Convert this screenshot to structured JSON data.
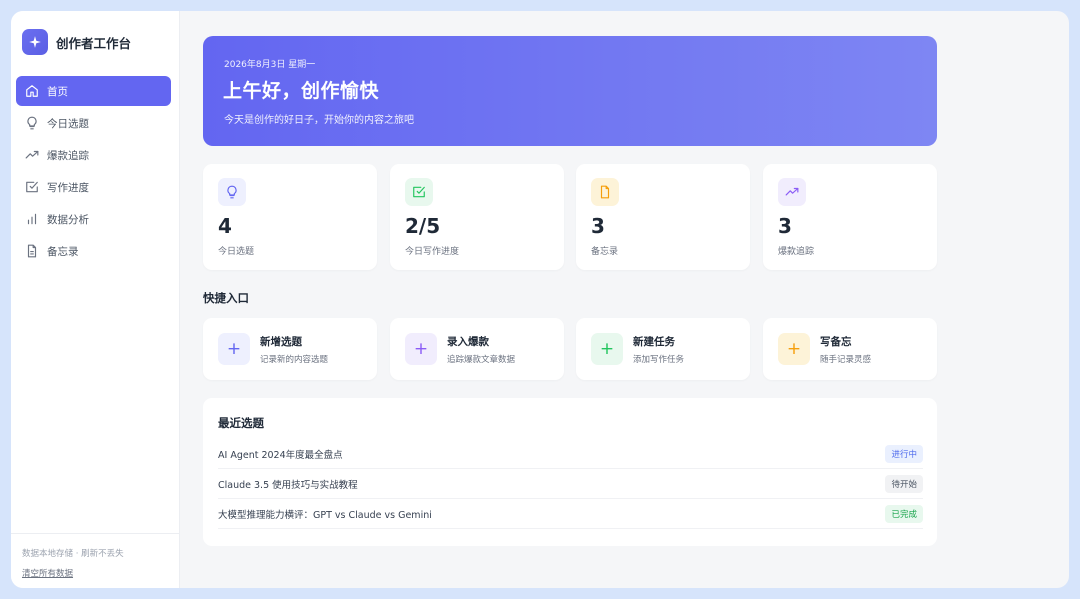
{
  "app": {
    "title": "创作者工作台"
  },
  "sidebar": {
    "items": [
      {
        "label": "首页",
        "icon": "home-icon",
        "active": true
      },
      {
        "label": "今日选题",
        "icon": "lightbulb-icon",
        "active": false
      },
      {
        "label": "爆款追踪",
        "icon": "trending-up-icon",
        "active": false
      },
      {
        "label": "写作进度",
        "icon": "checkbox-icon",
        "active": false
      },
      {
        "label": "数据分析",
        "icon": "bar-chart-icon",
        "active": false
      },
      {
        "label": "备忘录",
        "icon": "document-icon",
        "active": false
      }
    ],
    "footer_note": "数据本地存储 · 刷新不丢失",
    "clear_link": "清空所有数据"
  },
  "hero": {
    "date": "2026年8月3日 星期一",
    "greeting": "上午好，创作愉快",
    "subtitle": "今天是创作的好日子，开始你的内容之旅吧"
  },
  "stats": [
    {
      "value": "4",
      "label": "今日选题",
      "icon": "lightbulb-icon",
      "color": "#6366f1",
      "bg": "#eef0fe"
    },
    {
      "value": "2/5",
      "label": "今日写作进度",
      "icon": "checkbox-icon",
      "color": "#22c55e",
      "bg": "#e8f8ee"
    },
    {
      "value": "3",
      "label": "备忘录",
      "icon": "document-icon",
      "color": "#f59e0b",
      "bg": "#fdf3d8"
    },
    {
      "value": "3",
      "label": "爆款追踪",
      "icon": "trending-up-icon",
      "color": "#8b5cf6",
      "bg": "#f1edfd"
    }
  ],
  "quick": {
    "title": "快捷入口",
    "items": [
      {
        "title": "新增选题",
        "sub": "记录新的内容选题",
        "color": "#6366f1",
        "bg": "#eef0fe"
      },
      {
        "title": "录入爆款",
        "sub": "追踪爆款文章数据",
        "color": "#8b5cf6",
        "bg": "#f1edfd"
      },
      {
        "title": "新建任务",
        "sub": "添加写作任务",
        "color": "#22c55e",
        "bg": "#e8f8ee"
      },
      {
        "title": "写备忘",
        "sub": "随手记录灵感",
        "color": "#f59e0b",
        "bg": "#fdf3d8"
      }
    ]
  },
  "recent": {
    "title": "最近选题",
    "items": [
      {
        "title": "AI Agent 2024年度最全盘点",
        "status": "进行中",
        "color": "#4f6bed",
        "bg": "#eaf0fe"
      },
      {
        "title": "Claude 3.5 使用技巧与实战教程",
        "status": "待开始",
        "color": "#4b5563",
        "bg": "#f1f2f4"
      },
      {
        "title": "大模型推理能力横评：GPT vs Claude vs Gemini",
        "status": "已完成",
        "color": "#16a34a",
        "bg": "#e8f8ee"
      }
    ]
  }
}
